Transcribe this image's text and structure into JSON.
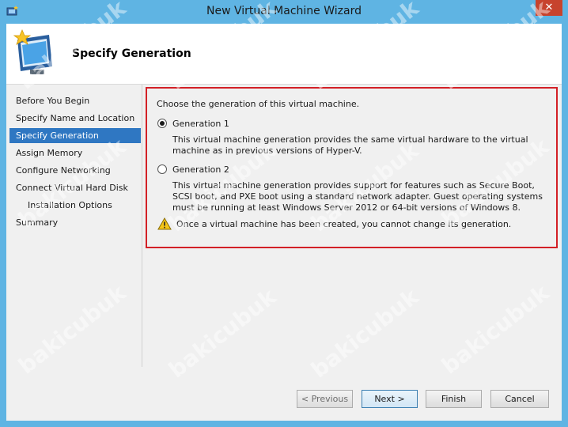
{
  "window": {
    "title": "New Virtual Machine Wizard",
    "close_glyph": "✕"
  },
  "header": {
    "title": "Specify Generation",
    "icon": "virtual-machine-icon"
  },
  "nav": {
    "items": [
      {
        "label": "Before You Begin",
        "selected": false,
        "sub": false
      },
      {
        "label": "Specify Name and Location",
        "selected": false,
        "sub": false
      },
      {
        "label": "Specify Generation",
        "selected": true,
        "sub": false
      },
      {
        "label": "Assign Memory",
        "selected": false,
        "sub": false
      },
      {
        "label": "Configure Networking",
        "selected": false,
        "sub": false
      },
      {
        "label": "Connect Virtual Hard Disk",
        "selected": false,
        "sub": false
      },
      {
        "label": "Installation Options",
        "selected": false,
        "sub": true
      },
      {
        "label": "Summary",
        "selected": false,
        "sub": false
      }
    ]
  },
  "main": {
    "prompt": "Choose the generation of this virtual machine.",
    "options": [
      {
        "label": "Generation 1",
        "checked": true,
        "description": "This virtual machine generation provides the same virtual hardware to the virtual machine as in previous versions of Hyper-V."
      },
      {
        "label": "Generation 2",
        "checked": false,
        "description": "This virtual machine generation provides support for features such as Secure Boot, SCSI boot, and PXE boot using a standard network adapter. Guest operating systems must be running at least Windows Server 2012 or 64-bit versions of Windows 8."
      }
    ],
    "warning": "Once a virtual machine has been created, you cannot change its generation."
  },
  "buttons": {
    "previous": "< Previous",
    "next": "Next >",
    "finish": "Finish",
    "cancel": "Cancel"
  },
  "watermark": "bakicubuk",
  "colors": {
    "accent": "#2f77c2",
    "highlight_border": "#d32026",
    "close": "#c7432d"
  }
}
